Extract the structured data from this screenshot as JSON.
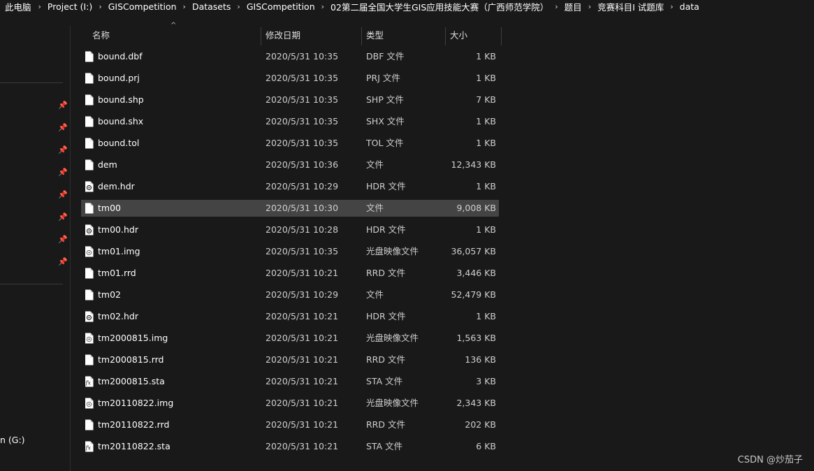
{
  "breadcrumb": [
    "此电脑",
    "Project (I:)",
    "GISCompetition",
    "Datasets",
    "GISCompetition",
    "02第二届全国大学生GIS应用技能大赛（广西师范学院）",
    "题目",
    "竞赛科目I  试题库",
    "data"
  ],
  "sidebar": {
    "drive_label": "n (G:)"
  },
  "columns": {
    "name": "名称",
    "date": "修改日期",
    "type": "类型",
    "size": "大小"
  },
  "files": [
    {
      "name": "bound.dbf",
      "date": "2020/5/31 10:35",
      "type": "DBF 文件",
      "size": "1 KB",
      "icon": "blank-file-icon"
    },
    {
      "name": "bound.prj",
      "date": "2020/5/31 10:35",
      "type": "PRJ 文件",
      "size": "1 KB",
      "icon": "blank-file-icon"
    },
    {
      "name": "bound.shp",
      "date": "2020/5/31 10:35",
      "type": "SHP 文件",
      "size": "7 KB",
      "icon": "blank-file-icon"
    },
    {
      "name": "bound.shx",
      "date": "2020/5/31 10:35",
      "type": "SHX 文件",
      "size": "1 KB",
      "icon": "blank-file-icon"
    },
    {
      "name": "bound.tol",
      "date": "2020/5/31 10:35",
      "type": "TOL 文件",
      "size": "1 KB",
      "icon": "blank-file-icon"
    },
    {
      "name": "dem",
      "date": "2020/5/31 10:36",
      "type": "文件",
      "size": "12,343 KB",
      "icon": "blank-file-icon"
    },
    {
      "name": "dem.hdr",
      "date": "2020/5/31 10:29",
      "type": "HDR 文件",
      "size": "1 KB",
      "icon": "hdr-file-icon"
    },
    {
      "name": "tm00",
      "date": "2020/5/31 10:30",
      "type": "文件",
      "size": "9,008 KB",
      "icon": "blank-file-icon",
      "selected": true
    },
    {
      "name": "tm00.hdr",
      "date": "2020/5/31 10:28",
      "type": "HDR 文件",
      "size": "1 KB",
      "icon": "hdr-file-icon"
    },
    {
      "name": "tm01.img",
      "date": "2020/5/31 10:35",
      "type": "光盘映像文件",
      "size": "36,057 KB",
      "icon": "disc-image-file-icon"
    },
    {
      "name": "tm01.rrd",
      "date": "2020/5/31 10:21",
      "type": "RRD 文件",
      "size": "3,446 KB",
      "icon": "blank-file-icon"
    },
    {
      "name": "tm02",
      "date": "2020/5/31 10:29",
      "type": "文件",
      "size": "52,479 KB",
      "icon": "blank-file-icon"
    },
    {
      "name": "tm02.hdr",
      "date": "2020/5/31 10:21",
      "type": "HDR 文件",
      "size": "1 KB",
      "icon": "hdr-file-icon"
    },
    {
      "name": "tm2000815.img",
      "date": "2020/5/31 10:21",
      "type": "光盘映像文件",
      "size": "1,563 KB",
      "icon": "disc-image-file-icon"
    },
    {
      "name": "tm2000815.rrd",
      "date": "2020/5/31 10:21",
      "type": "RRD 文件",
      "size": "136 KB",
      "icon": "blank-file-icon"
    },
    {
      "name": "tm2000815.sta",
      "date": "2020/5/31 10:21",
      "type": "STA 文件",
      "size": "3 KB",
      "icon": "fx-file-icon"
    },
    {
      "name": "tm20110822.img",
      "date": "2020/5/31 10:21",
      "type": "光盘映像文件",
      "size": "2,343 KB",
      "icon": "disc-image-file-icon"
    },
    {
      "name": "tm20110822.rrd",
      "date": "2020/5/31 10:21",
      "type": "RRD 文件",
      "size": "202 KB",
      "icon": "blank-file-icon"
    },
    {
      "name": "tm20110822.sta",
      "date": "2020/5/31 10:21",
      "type": "STA 文件",
      "size": "6 KB",
      "icon": "fx-file-icon"
    }
  ],
  "watermark": "CSDN @炒茄子",
  "colors": {
    "background": "#191919",
    "selected_row": "#444444",
    "text": "#ffffff",
    "muted_text": "#cfcfcf"
  }
}
